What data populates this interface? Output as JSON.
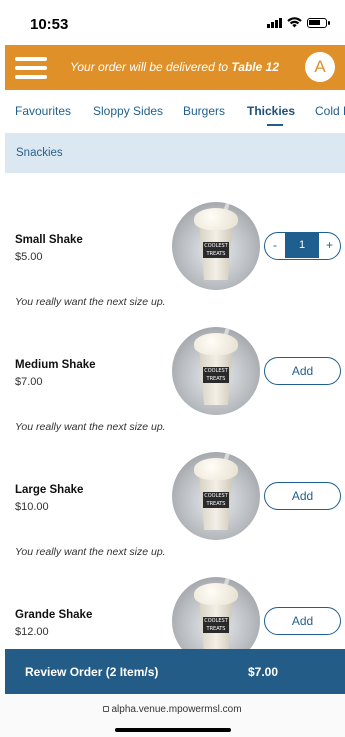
{
  "status_bar": {
    "time": "10:53"
  },
  "header": {
    "delivery_prefix": "Your order will be delivered to ",
    "delivery_table": "Table 12",
    "avatar_initial": "A"
  },
  "tabs": [
    {
      "label": "Favourites"
    },
    {
      "label": "Sloppy Sides"
    },
    {
      "label": "Burgers"
    },
    {
      "label": "Thickies",
      "active": true
    },
    {
      "label": "Cold D"
    }
  ],
  "subcategory": {
    "label": "Snackies"
  },
  "products": [
    {
      "name": "Small Shake",
      "price": "$5.00",
      "description": "You really want the next size up.",
      "action": "stepper",
      "quantity": "1",
      "minus": "-",
      "plus": "+"
    },
    {
      "name": "Medium Shake",
      "price": "$7.00",
      "description": "You really want the next size up.",
      "action": "add",
      "add_label": "Add"
    },
    {
      "name": "Large Shake",
      "price": "$10.00",
      "description": "You really want the next size up.",
      "action": "add",
      "add_label": "Add"
    },
    {
      "name": "Grande Shake",
      "price": "$12.00",
      "action": "add",
      "add_label": "Add"
    }
  ],
  "image_label": "COOLEST TREATS",
  "review": {
    "label": "Review Order (2 Item/s)",
    "total": "$7.00"
  },
  "browser": {
    "url": "alpha.venue.mpowermsl.com"
  },
  "colors": {
    "header_bg": "#e09028",
    "primary": "#1f5f8f",
    "review_bg": "#235d87",
    "subbar_bg": "#dbe8f2"
  }
}
